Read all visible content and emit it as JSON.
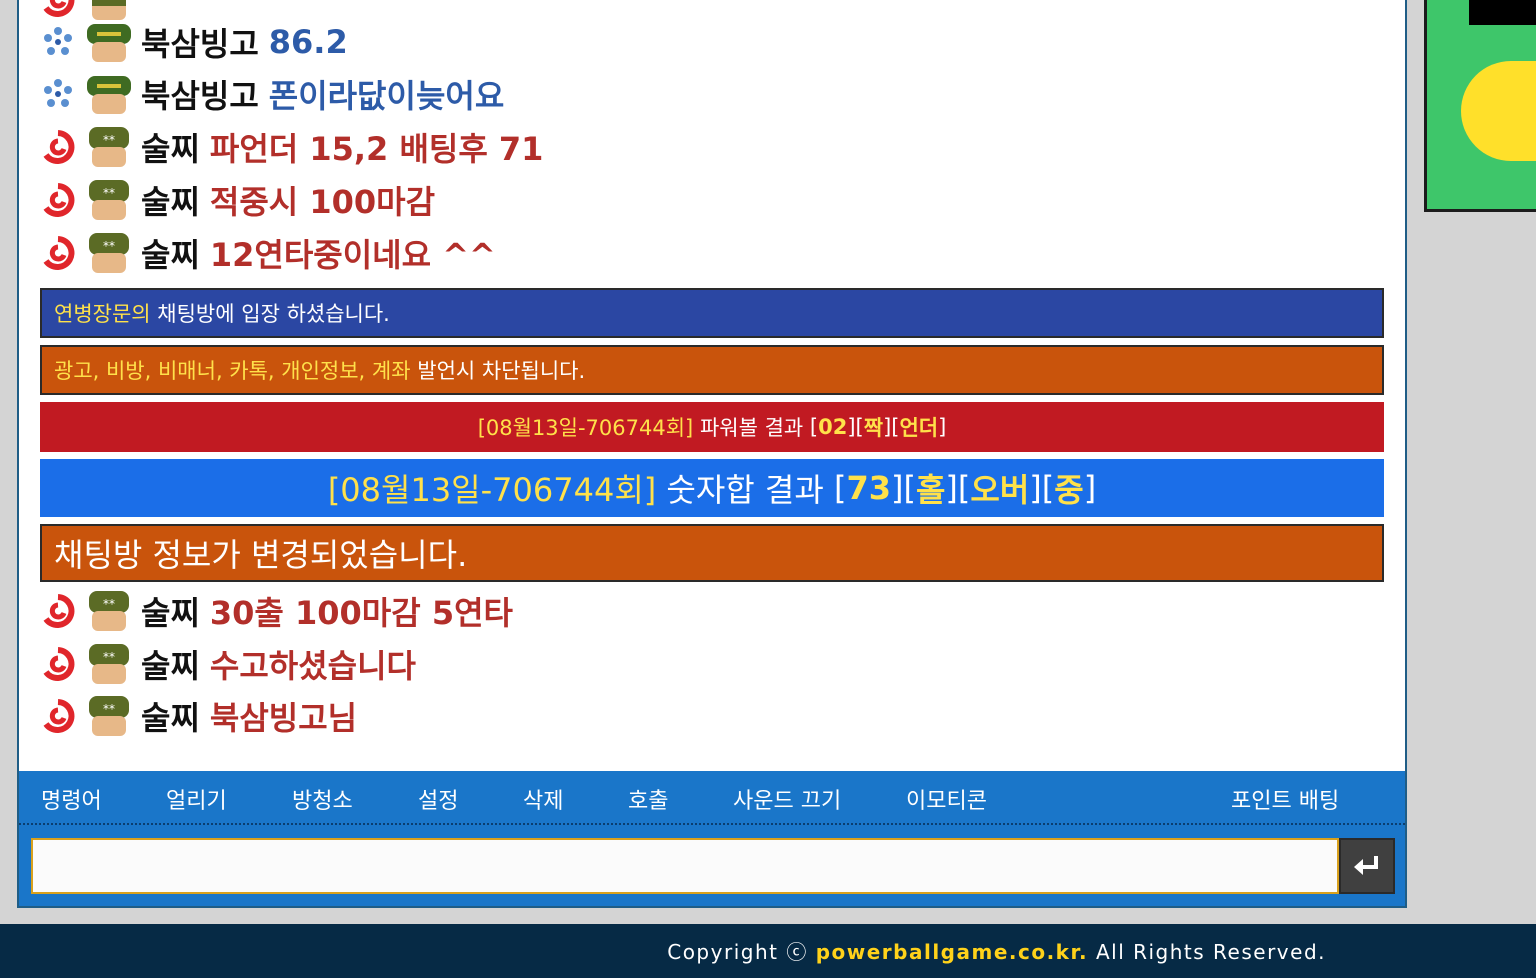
{
  "chat": {
    "messages": [
      {
        "level": "bronze",
        "nick": "",
        "text": "",
        "color": "red"
      },
      {
        "level": "blue",
        "nick": "북삼빙고",
        "text": "86.2",
        "color": "blue"
      },
      {
        "level": "blue",
        "nick": "북삼빙고",
        "text": "폰이라닶이늦어요",
        "color": "blue"
      },
      {
        "level": "red",
        "nick": "술찌",
        "text": "파언더 15,2 배팅후 71",
        "color": "red"
      },
      {
        "level": "red",
        "nick": "술찌",
        "text": "적중시 100마감",
        "color": "red"
      },
      {
        "level": "red",
        "nick": "술찌",
        "text": "12연타중이네요 ^^",
        "color": "red"
      },
      {
        "level": "red",
        "nick": "술찌",
        "text": "30출 100마감 5연타",
        "color": "red"
      },
      {
        "level": "red",
        "nick": "술찌",
        "text": "수고하셨습니다",
        "color": "red"
      },
      {
        "level": "red",
        "nick": "술찌",
        "text": "북삼빙고님",
        "color": "red"
      }
    ],
    "join_notice": {
      "user": "연병장문의",
      "text": "채팅방에 입장 하셨습니다."
    },
    "warning_notice": {
      "keywords": "광고, 비방, 비매너, 카톡, 개인정보, 계좌",
      "text": "발언시 차단됩니다."
    },
    "powerball_result": {
      "round": "[08월13일-706744회]",
      "label": "파워볼 결과",
      "open": "[",
      "number": "02",
      "close1": "][",
      "oddeven": "짝",
      "close2": "][",
      "underover": "언더",
      "close3": "]"
    },
    "sum_result": {
      "round": "[08월13일-706744회]",
      "label": "숫자합 결과",
      "open": "[",
      "number": "73",
      "sep1": "][",
      "oddeven": "홀",
      "sep2": "][",
      "underover": "오버",
      "sep3": "][",
      "size": "중",
      "close": "]"
    },
    "info_notice": "채팅방 정보가 변경되었습니다."
  },
  "toolbar": {
    "menu": [
      "명령어",
      "얼리기",
      "방청소",
      "설정",
      "삭제",
      "호출",
      "사운드 끄기",
      "이모티콘",
      "포인트 배팅"
    ],
    "input_placeholder": "",
    "send_icon": "enter-icon"
  },
  "footer": {
    "prefix": "Copyright ⓒ ",
    "site": "powerballgame.co.kr.",
    "suffix": " All Rights Reserved."
  },
  "colors": {
    "blue_text": "#2d5ba8",
    "red_text": "#b22f2a",
    "join_bar": "#2b47a3",
    "warn_bar": "#c9540c",
    "powerball_bar": "#c11a22",
    "sum_bar": "#1b6ee8",
    "toolbar": "#1a76c9",
    "footer": "#062a45",
    "highlight": "#ffe14a"
  }
}
